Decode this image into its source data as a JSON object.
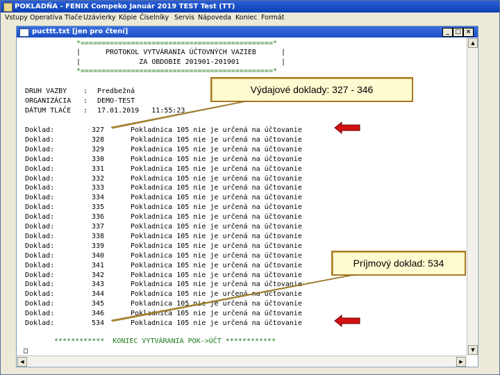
{
  "app": {
    "title": "POKLADŇA - FENIX Compeko  Január 2019  TEST Test (TT)"
  },
  "menu": [
    "Vstupy",
    "Operatíva",
    "Tlače",
    "Uzávierky",
    "Kópie",
    "Číselníky",
    "Servis",
    "Nápoveda",
    "Koniec",
    "Formát"
  ],
  "document": {
    "title": "pucttt.txt [jen pro čtení]",
    "header_border": "*==============================================*",
    "header_line1": "|      PROTOKOL VYTVÁRANIA ÚČTOVNÝCH VAZIEB      |",
    "header_line2": "|              ZA OBDOBIE 201901-201901          |",
    "meta": [
      {
        "label": "DRUH VAZBY",
        "value": "Predbežná"
      },
      {
        "label": "ORGANIZÁCIA",
        "value": "DEMO-TEST"
      },
      {
        "label": "DÁTUM TLAČE",
        "value": "17.01.2019   11:55:23"
      }
    ],
    "row_label": "Doklad:",
    "row_text": "Pokladnica 105 nie je určená na účtovanie",
    "rows": [
      "327",
      "328",
      "329",
      "330",
      "331",
      "332",
      "333",
      "334",
      "335",
      "336",
      "337",
      "338",
      "339",
      "340",
      "341",
      "342",
      "343",
      "344",
      "345",
      "346",
      "534"
    ],
    "footer": "************  KONIEC VYTVÁRANIA POK->ÚČT ************",
    "cursor_char": "□"
  },
  "callouts": {
    "vydajove": "Výdajové doklady: 327 - 346",
    "prijmovy": "Príjmový doklad: 534"
  },
  "colors": {
    "title_bar": "#0a3fb6",
    "callout_bg": "#fffbd0",
    "callout_border": "#a87a20",
    "arrow": "#d11010"
  }
}
